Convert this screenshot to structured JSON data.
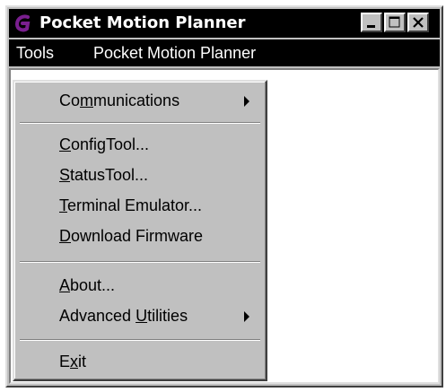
{
  "window": {
    "title": "Pocket Motion Planner",
    "buttons": {
      "minimize": "minimize-icon",
      "maximize": "maximize-icon",
      "close": "close-icon"
    }
  },
  "menubar": {
    "tools": "Tools",
    "app": "Pocket Motion Planner"
  },
  "menu": {
    "items": [
      {
        "label": "Communications",
        "mnemonic": "m",
        "submenu": true
      },
      {
        "label": "ConfigTool...",
        "mnemonic": "C",
        "submenu": false
      },
      {
        "label": "StatusTool...",
        "mnemonic": "S",
        "submenu": false
      },
      {
        "label": "Terminal Emulator...",
        "mnemonic": "T",
        "submenu": false
      },
      {
        "label": "Download Firmware",
        "mnemonic": "D",
        "submenu": false
      },
      {
        "label": "About...",
        "mnemonic": "A",
        "submenu": false
      },
      {
        "label": "Advanced Utilities",
        "mnemonic": "U",
        "submenu": true
      },
      {
        "label": "Exit",
        "mnemonic": "x",
        "submenu": false
      }
    ]
  },
  "colors": {
    "titlebar": "#000000",
    "face": "#c0c0c0",
    "app_icon": "#7a1f8f"
  }
}
